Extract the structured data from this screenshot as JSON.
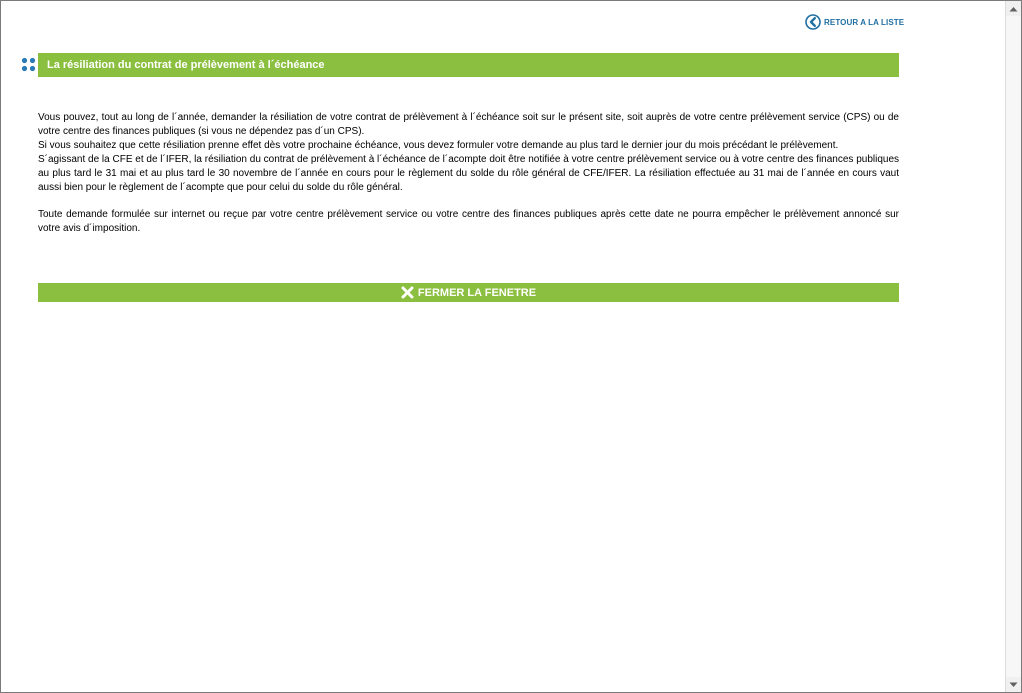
{
  "nav": {
    "back_label": "RETOUR A LA LISTE"
  },
  "section": {
    "title": "La résiliation du contrat de prélèvement à l´échéance"
  },
  "body": {
    "paragraphs": [
      "Vous pouvez, tout au long de l´année, demander la résiliation de votre contrat de prélèvement à l´échéance soit sur le présent site, soit auprès de votre centre prélèvement service (CPS) ou de votre centre des finances publiques (si vous ne dépendez pas d´un CPS).",
      "Si vous souhaitez que cette résiliation prenne effet dès votre prochaine échéance, vous devez formuler votre demande au plus tard le dernier jour du mois précédant le prélèvement.",
      "S´agissant de la CFE et de l´IFER, la résiliation du contrat de prélèvement à l´échéance de l´acompte doit être notifiée à votre centre prélèvement service ou à votre centre des finances publiques au plus tard le 31 mai et au plus tard le 30 novembre de l´année en cours pour le règlement du solde du rôle général de CFE/IFER. La résiliation effectuée au 31 mai de l´année en cours vaut aussi bien pour le règlement de l´acompte que pour celui du solde du rôle général.",
      "Toute demande formulée sur internet ou reçue par votre centre prélèvement service ou votre centre des finances publiques après cette date ne pourra empêcher le prélèvement annoncé sur votre avis d´imposition."
    ]
  },
  "actions": {
    "close_label": "FERMER LA FENETRE"
  },
  "icons": {
    "back": "back-arrow-circle-icon",
    "bullet": "dots-bullet-icon",
    "close": "close-x-icon",
    "scroll_up": "scroll-up-arrow-icon",
    "scroll_down": "scroll-down-arrow-icon"
  },
  "colors": {
    "accent_green": "#8bbf3f",
    "link_blue": "#1f6fa3",
    "bullet_blue": "#2a7ab8"
  }
}
